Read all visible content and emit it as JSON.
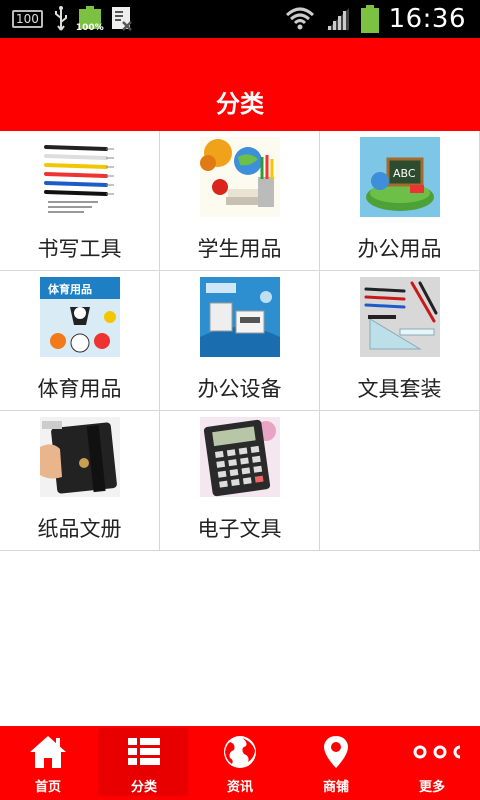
{
  "statusbar": {
    "notif_box": "100",
    "battery_small_pct": "100%",
    "time": "16:36"
  },
  "header": {
    "title": "分类"
  },
  "categories": [
    {
      "label": "书写工具",
      "icon": "pens-photo"
    },
    {
      "label": "学生用品",
      "icon": "school-supplies-photo"
    },
    {
      "label": "办公用品",
      "icon": "office-supplies-photo"
    },
    {
      "label": "体育用品",
      "icon": "sports-goods-photo",
      "thumb_text": "体育用品"
    },
    {
      "label": "办公设备",
      "icon": "office-equipment-photo"
    },
    {
      "label": "文具套装",
      "icon": "stationery-set-photo"
    },
    {
      "label": "纸品文册",
      "icon": "notebook-photo"
    },
    {
      "label": "电子文具",
      "icon": "calculator-photo"
    }
  ],
  "bottomnav": {
    "items": [
      {
        "label": "首页",
        "icon": "home-icon"
      },
      {
        "label": "分类",
        "icon": "category-list-icon",
        "active": true
      },
      {
        "label": "资讯",
        "icon": "globe-icon"
      },
      {
        "label": "商铺",
        "icon": "location-pin-icon"
      },
      {
        "label": "更多",
        "icon": "more-dots-icon"
      }
    ]
  },
  "colors": {
    "brand_red": "#ff0000",
    "active_tab": "#e80000",
    "status_green": "#7cc142"
  }
}
